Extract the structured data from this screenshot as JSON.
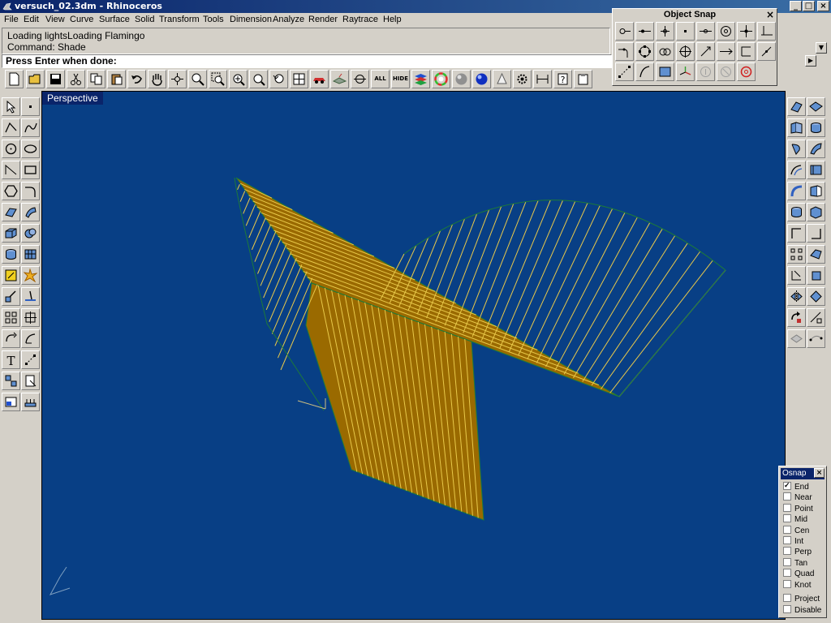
{
  "window": {
    "title": "versuch_02.3dm - Rhinoceros",
    "min": "_",
    "max": "□",
    "close": "×"
  },
  "menu": [
    "File",
    "Edit",
    "View",
    "Curve",
    "Surface",
    "Solid",
    "Transform",
    "Tools",
    "Dimension",
    "Analyze",
    "Render",
    "Raytrace",
    "Help"
  ],
  "command": {
    "history_1": "Loading lightsLoading Flamingo",
    "history_2": "Command: Shade",
    "prompt": "Press Enter when done:"
  },
  "toolbar": {
    "all_label": "ALL",
    "hide_label": "HIDE"
  },
  "viewport": {
    "label": "Perspective",
    "bg_color": "#083f85",
    "surface_color": "#9a6a00",
    "line_color": "#e8c84a"
  },
  "object_snap_palette": {
    "title": "Object Snap",
    "close": "×"
  },
  "osnap_panel": {
    "title": "Osnap",
    "close": "×",
    "options": [
      {
        "label": "End",
        "checked": true
      },
      {
        "label": "Near",
        "checked": false
      },
      {
        "label": "Point",
        "checked": false
      },
      {
        "label": "Mid",
        "checked": false
      },
      {
        "label": "Cen",
        "checked": false
      },
      {
        "label": "Int",
        "checked": false
      },
      {
        "label": "Perp",
        "checked": false
      },
      {
        "label": "Tan",
        "checked": false
      },
      {
        "label": "Quad",
        "checked": false
      },
      {
        "label": "Knot",
        "checked": false
      }
    ],
    "extra": [
      {
        "label": "Project",
        "checked": false
      },
      {
        "label": "Disable",
        "checked": false
      }
    ]
  }
}
